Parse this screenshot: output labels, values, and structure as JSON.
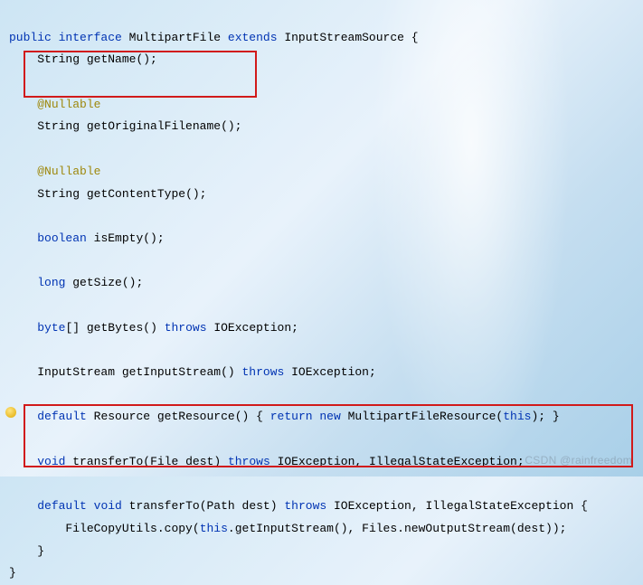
{
  "code": {
    "l1_kw_public": "public",
    "l1_kw_interface": "interface",
    "l1_name": "MultipartFile",
    "l1_kw_extends": "extends",
    "l1_super": "InputStreamSource",
    "l1_brace": "{",
    "l2_type": "String",
    "l2_method": "getName",
    "l2_paren": "();",
    "l4_anno": "@Nullable",
    "l5_type": "String",
    "l5_method": "getOriginalFilename",
    "l5_paren": "();",
    "l7_anno": "@Nullable",
    "l8_type": "String",
    "l8_method": "getContentType",
    "l8_paren": "();",
    "l10_kw": "boolean",
    "l10_method": "isEmpty",
    "l10_paren": "();",
    "l12_kw": "long",
    "l12_method": "getSize",
    "l12_paren": "();",
    "l14_kw": "byte",
    "l14_arr": "[]",
    "l14_method": "getBytes",
    "l14_paren": "()",
    "l14_throws": "throws",
    "l14_ex": "IOException",
    "l14_semi": ";",
    "l16_type": "InputStream",
    "l16_method": "getInputStream",
    "l16_paren": "()",
    "l16_throws": "throws",
    "l16_ex": "IOException",
    "l16_semi": ";",
    "l18_kw_default": "default",
    "l18_type": "Resource",
    "l18_method": "getResource",
    "l18_paren": "()",
    "l18_brace": "{",
    "l18_kw_return": "return",
    "l18_kw_new": "new",
    "l18_ctor": "MultipartFileResource",
    "l18_open": "(",
    "l18_kw_this": "this",
    "l18_close": ");",
    "l18_rbrace": "}",
    "l20_kw_void": "void",
    "l20_method": "transferTo",
    "l20_open": "(",
    "l20_ptype": "File",
    "l20_pname": "dest",
    "l20_close": ")",
    "l20_throws": "throws",
    "l20_ex1": "IOException",
    "l20_comma": ",",
    "l20_ex2": "IllegalStateException",
    "l20_semi": ";",
    "l22_kw_default": "default",
    "l22_kw_void": "void",
    "l22_method": "transferTo",
    "l22_open": "(",
    "l22_ptype": "Path",
    "l22_pname": "dest",
    "l22_close": ")",
    "l22_throws": "throws",
    "l22_ex1": "IOException",
    "l22_comma": ",",
    "l22_ex2": "IllegalStateException",
    "l22_brace": "{",
    "l23_cls": "FileCopyUtils",
    "l23_dot1": ".",
    "l23_m1": "copy",
    "l23_open": "(",
    "l23_kw_this": "this",
    "l23_dot2": ".",
    "l23_m2": "getInputStream",
    "l23_par2": "(),",
    "l23_cls2": "Files",
    "l23_dot3": ".",
    "l23_m3": "newOutputStream",
    "l23_open3": "(",
    "l23_arg": "dest",
    "l23_close": "));",
    "l24_brace": "}",
    "l25_brace": "}"
  },
  "watermark": "CSDN @rainfreedom"
}
